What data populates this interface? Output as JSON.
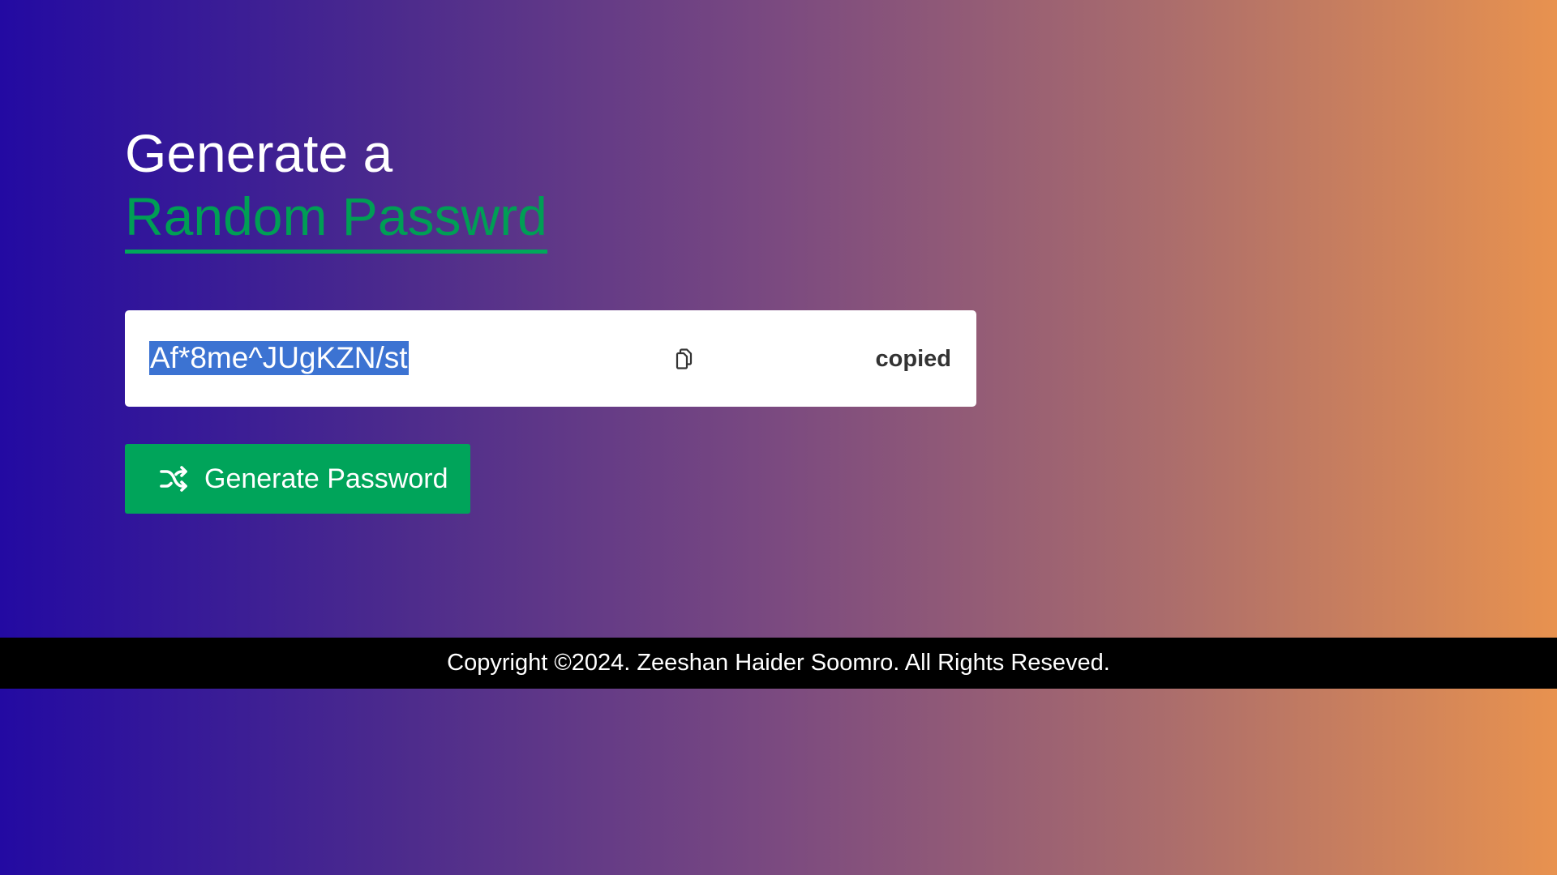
{
  "heading": {
    "line1": "Generate a",
    "line2": "Random Passwrd"
  },
  "password": {
    "value": "Af*8me^JUgKZN/st",
    "copy_icon": "copy-icon",
    "status": "copied"
  },
  "generate_button": {
    "label": "Generate Password",
    "icon": "shuffle-icon"
  },
  "footer": {
    "text": "Copyright ©2024. Zeeshan Haider Soomro. All Rights Reseved."
  },
  "colors": {
    "gradient_start": "#230aa2",
    "gradient_end": "#e8924f",
    "accent_green": "#00a45a",
    "highlight": "#3c73d2"
  }
}
